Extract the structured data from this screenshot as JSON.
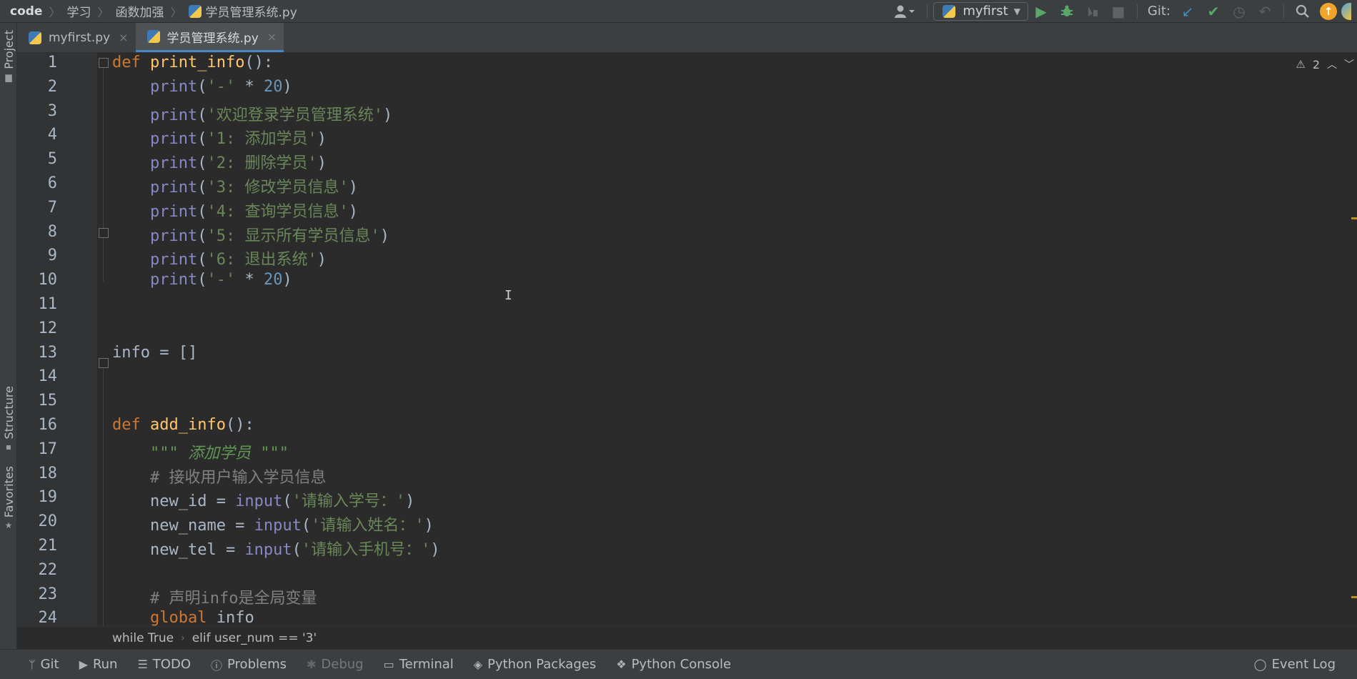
{
  "breadcrumb": {
    "project": "code",
    "folder1": "学习",
    "folder2": "函数加强",
    "file": "学员管理系统.py"
  },
  "toolbar": {
    "run_config": "myfirst",
    "git_label": "Git:",
    "icons": [
      "user-icon",
      "run-icon",
      "debug-icon",
      "coverage-icon",
      "stop-icon",
      "git-update-icon",
      "git-commit-icon",
      "history-icon",
      "rollback-icon",
      "search-icon",
      "update-icon"
    ]
  },
  "left_strip": {
    "project": "Project",
    "structure": "Structure",
    "favorites": "Favorites"
  },
  "tabs": [
    {
      "label": "myfirst.py",
      "active": false
    },
    {
      "label": "学员管理系统.py",
      "active": true
    }
  ],
  "editor": {
    "warning_count": "2",
    "lines": [
      [
        {
          "t": "def ",
          "c": "kw"
        },
        {
          "t": "print_info",
          "c": "fn"
        },
        {
          "t": "():",
          "c": "plain"
        }
      ],
      [
        {
          "t": "    ",
          "c": "plain"
        },
        {
          "t": "print",
          "c": "bi"
        },
        {
          "t": "(",
          "c": "plain"
        },
        {
          "t": "'-'",
          "c": "str"
        },
        {
          "t": " * ",
          "c": "plain"
        },
        {
          "t": "20",
          "c": "num"
        },
        {
          "t": ")",
          "c": "plain"
        }
      ],
      [
        {
          "t": "    ",
          "c": "plain"
        },
        {
          "t": "print",
          "c": "bi"
        },
        {
          "t": "(",
          "c": "plain"
        },
        {
          "t": "'欢迎登录学员管理系统'",
          "c": "str"
        },
        {
          "t": ")",
          "c": "plain"
        }
      ],
      [
        {
          "t": "    ",
          "c": "plain"
        },
        {
          "t": "print",
          "c": "bi"
        },
        {
          "t": "(",
          "c": "plain"
        },
        {
          "t": "'1: 添加学员'",
          "c": "str"
        },
        {
          "t": ")",
          "c": "plain"
        }
      ],
      [
        {
          "t": "    ",
          "c": "plain"
        },
        {
          "t": "print",
          "c": "bi"
        },
        {
          "t": "(",
          "c": "plain"
        },
        {
          "t": "'2: 删除学员'",
          "c": "str"
        },
        {
          "t": ")",
          "c": "plain"
        }
      ],
      [
        {
          "t": "    ",
          "c": "plain"
        },
        {
          "t": "print",
          "c": "bi"
        },
        {
          "t": "(",
          "c": "plain"
        },
        {
          "t": "'3: 修改学员信息'",
          "c": "str"
        },
        {
          "t": ")",
          "c": "plain"
        }
      ],
      [
        {
          "t": "    ",
          "c": "plain"
        },
        {
          "t": "print",
          "c": "bi"
        },
        {
          "t": "(",
          "c": "plain"
        },
        {
          "t": "'4: 查询学员信息'",
          "c": "str"
        },
        {
          "t": ")",
          "c": "plain"
        }
      ],
      [
        {
          "t": "    ",
          "c": "plain"
        },
        {
          "t": "print",
          "c": "bi"
        },
        {
          "t": "(",
          "c": "plain"
        },
        {
          "t": "'5: 显示所有学员信息'",
          "c": "str"
        },
        {
          "t": ")",
          "c": "plain"
        }
      ],
      [
        {
          "t": "    ",
          "c": "plain"
        },
        {
          "t": "print",
          "c": "bi"
        },
        {
          "t": "(",
          "c": "plain"
        },
        {
          "t": "'6: 退出系统'",
          "c": "str"
        },
        {
          "t": ")",
          "c": "plain"
        }
      ],
      [
        {
          "t": "    ",
          "c": "plain"
        },
        {
          "t": "print",
          "c": "bi"
        },
        {
          "t": "(",
          "c": "plain"
        },
        {
          "t": "'-'",
          "c": "str"
        },
        {
          "t": " * ",
          "c": "plain"
        },
        {
          "t": "20",
          "c": "num"
        },
        {
          "t": ")",
          "c": "plain"
        }
      ],
      [],
      [],
      [
        {
          "t": "info = []",
          "c": "plain"
        }
      ],
      [],
      [],
      [
        {
          "t": "def ",
          "c": "kw"
        },
        {
          "t": "add_info",
          "c": "fn"
        },
        {
          "t": "():",
          "c": "plain"
        }
      ],
      [
        {
          "t": "    ",
          "c": "plain"
        },
        {
          "t": "\"\"\" 添加学员 \"\"\"",
          "c": "doc"
        }
      ],
      [
        {
          "t": "    ",
          "c": "plain"
        },
        {
          "t": "# 接收用户输入学员信息",
          "c": "cmt"
        }
      ],
      [
        {
          "t": "    new_id = ",
          "c": "plain"
        },
        {
          "t": "input",
          "c": "bi"
        },
        {
          "t": "(",
          "c": "plain"
        },
        {
          "t": "'请输入学号：'",
          "c": "str"
        },
        {
          "t": ")",
          "c": "plain"
        }
      ],
      [
        {
          "t": "    new_name = ",
          "c": "plain"
        },
        {
          "t": "input",
          "c": "bi"
        },
        {
          "t": "(",
          "c": "plain"
        },
        {
          "t": "'请输入姓名：'",
          "c": "str"
        },
        {
          "t": ")",
          "c": "plain"
        }
      ],
      [
        {
          "t": "    new_tel = ",
          "c": "plain"
        },
        {
          "t": "input",
          "c": "bi"
        },
        {
          "t": "(",
          "c": "plain"
        },
        {
          "t": "'请输入手机号：'",
          "c": "str"
        },
        {
          "t": ")",
          "c": "plain"
        }
      ],
      [],
      [
        {
          "t": "    ",
          "c": "plain"
        },
        {
          "t": "# 声明info是全局变量",
          "c": "cmt"
        }
      ],
      [
        {
          "t": "    ",
          "c": "plain"
        },
        {
          "t": "global",
          "c": "kw"
        },
        {
          "t": " info",
          "c": "plain"
        }
      ]
    ]
  },
  "code_breadcrumb": {
    "item1": "while True",
    "item2": "elif user_num == '3'"
  },
  "bottom_tools": {
    "git": "Git",
    "run": "Run",
    "todo": "TODO",
    "problems": "Problems",
    "debug": "Debug",
    "terminal": "Terminal",
    "python_packages": "Python Packages",
    "python_console": "Python Console",
    "event_log": "Event Log"
  }
}
